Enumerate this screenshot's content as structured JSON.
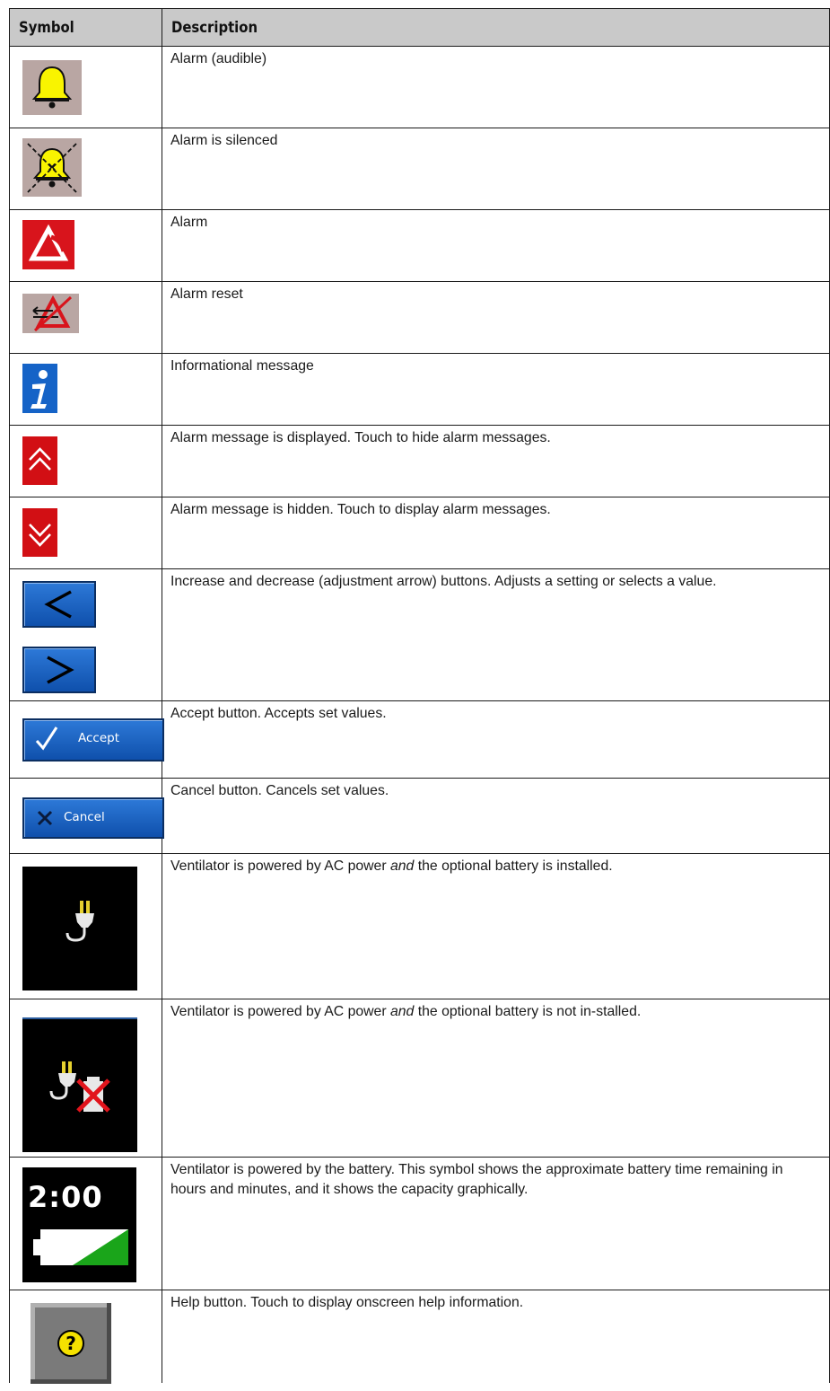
{
  "table": {
    "headers": {
      "symbol": "Symbol",
      "description": "Description"
    },
    "rows": [
      {
        "icon": "bell-alarm-audible-icon",
        "description": "Alarm (audible)"
      },
      {
        "icon": "bell-alarm-silenced-icon",
        "description": "Alarm is silenced"
      },
      {
        "icon": "alarm-triangle-icon",
        "description": "Alarm"
      },
      {
        "icon": "alarm-reset-icon",
        "description": "Alarm reset"
      },
      {
        "icon": "info-icon",
        "description": "Informational message"
      },
      {
        "icon": "chevron-double-up-icon",
        "description": "Alarm message is displayed. Touch to hide alarm messages."
      },
      {
        "icon": "chevron-double-down-icon",
        "description": "Alarm message is hidden. Touch to display alarm messages."
      },
      {
        "icon": "adjustment-arrows-icon",
        "description": "Increase and decrease (adjustment arrow) buttons. Adjusts a setting or selects a value."
      },
      {
        "icon": "accept-button-icon",
        "button_label": "Accept",
        "description": "Accept button. Accepts set values."
      },
      {
        "icon": "cancel-button-icon",
        "button_label": "Cancel",
        "description": "Cancel button. Cancels set values."
      },
      {
        "icon": "ac-power-icon",
        "description_pre": "Ventilator is powered by AC power ",
        "description_em": "and",
        "description_post": " the optional battery is installed."
      },
      {
        "icon": "ac-power-no-battery-icon",
        "description_pre": "Ventilator is powered by AC power ",
        "description_em": "and",
        "description_post": " the optional battery is not in-stalled."
      },
      {
        "icon": "battery-power-icon",
        "battery_time": "2:00",
        "description": "Ventilator is powered by the battery. This symbol shows the approximate battery time remaining in hours and minutes, and it shows the capacity graphically."
      },
      {
        "icon": "help-icon",
        "description": "Help button. Touch to display onscreen help information."
      }
    ]
  },
  "colors": {
    "header_bg": "#c9c9c9",
    "alarm_red": "#d8141c",
    "bell_yellow": "#f9f400",
    "button_blue": "#1563c7",
    "battery_green": "#1aa51a"
  }
}
